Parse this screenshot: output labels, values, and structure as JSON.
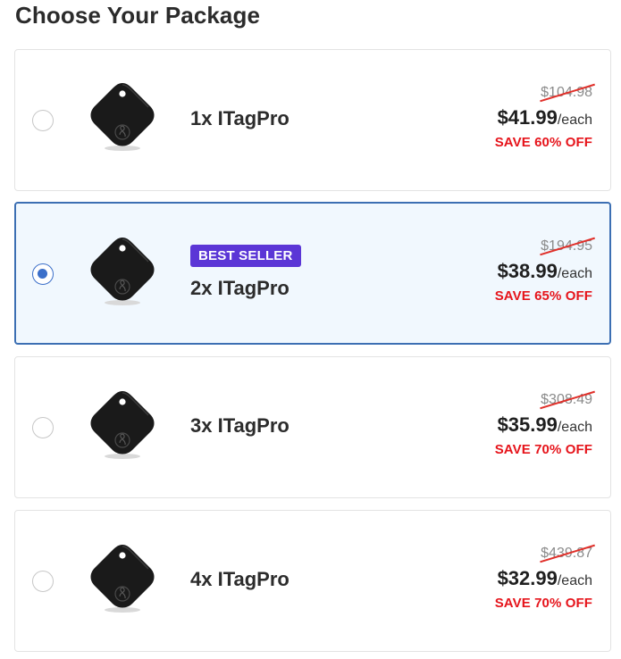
{
  "heading": "Choose Your Package",
  "packages": [
    {
      "name": "1x ITagPro",
      "old_price": "$104.98",
      "price": "$41.99",
      "unit": "/each",
      "save": "SAVE 60% OFF",
      "selected": false
    },
    {
      "name": "2x ITagPro",
      "badge": "BEST SELLER",
      "old_price": "$194.95",
      "price": "$38.99",
      "unit": "/each",
      "save": "SAVE 65% OFF",
      "selected": true
    },
    {
      "name": "3x ITagPro",
      "old_price": "$308.49",
      "price": "$35.99",
      "unit": "/each",
      "save": "SAVE 70% OFF",
      "selected": false
    },
    {
      "name": "4x ITagPro",
      "old_price": "$439.87",
      "price": "$32.99",
      "unit": "/each",
      "save": "SAVE 70% OFF",
      "selected": false
    }
  ],
  "colors": {
    "selected_border": "#3c6fb3",
    "selected_background": "#f1f8fe",
    "badge": "#5b36d6",
    "save_text": "#e6141b",
    "radio_selected": "#3b6fc9"
  },
  "icons": {
    "product_image": "tracker-tag-icon",
    "radio": "radio-button"
  }
}
